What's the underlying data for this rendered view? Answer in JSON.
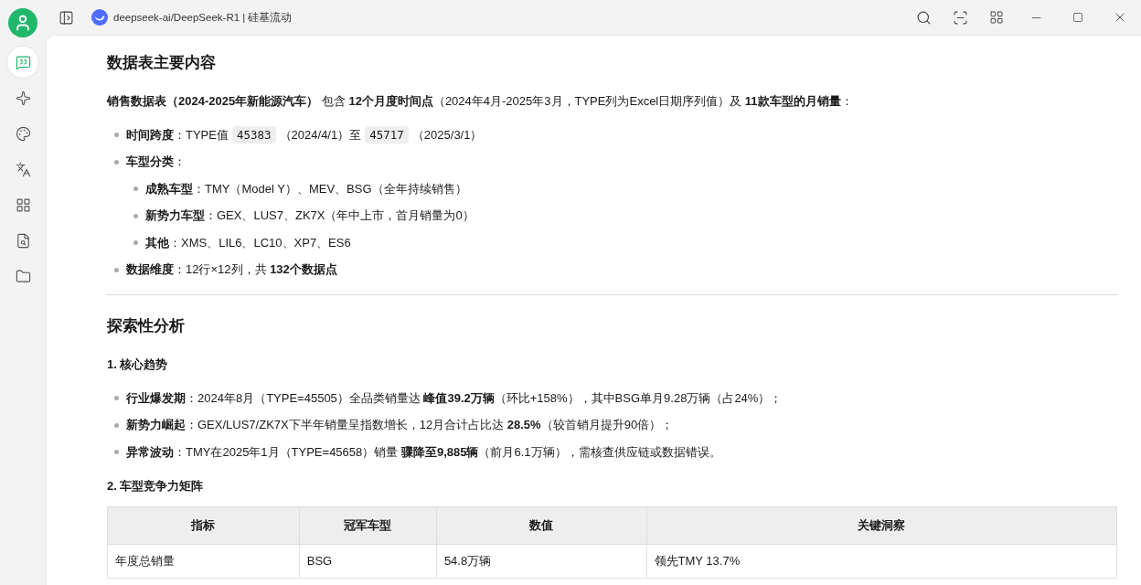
{
  "window": {
    "title": "deepseek-ai/DeepSeek-R1 | 硅基流动"
  },
  "sidebar": {
    "items": [
      {
        "selected": true
      },
      {
        "selected": false
      },
      {
        "selected": false
      },
      {
        "selected": false
      },
      {
        "selected": false
      },
      {
        "selected": false
      },
      {
        "selected": false
      }
    ]
  },
  "content": [
    {
      "kind": "heading",
      "text": "数据表主要内容"
    },
    {
      "kind": "paragraph",
      "text": "**销售数据表（2024-2025年新能源汽车）** 包含 **12个月度时间点**（2024年4月-2025年3月，TYPE列为Excel日期序列值）及 **11款车型的月销量**："
    },
    {
      "kind": "list",
      "items": [
        {
          "segments": [
            {
              "kind": "text",
              "text": "**时间跨度**：TYPE值"
            },
            {
              "kind": "code",
              "text": "45383"
            },
            {
              "kind": "text",
              "text": "（2024/4/1）至"
            },
            {
              "kind": "code",
              "text": "45717"
            },
            {
              "kind": "text",
              "text": "（2025/3/1）"
            }
          ]
        },
        {
          "segments": [
            {
              "kind": "text",
              "text": "**车型分类**："
            }
          ],
          "children": [
            {
              "segments": [
                {
                  "kind": "text",
                  "text": "**成熟车型**：TMY（Model Y）、MEV、BSG（全年持续销售）"
                }
              ]
            },
            {
              "segments": [
                {
                  "kind": "text",
                  "text": "**新势力车型**：GEX、LUS7、ZK7X（年中上市，首月销量为0）"
                }
              ]
            },
            {
              "segments": [
                {
                  "kind": "text",
                  "text": "**其他**：XMS、LIL6、LC10、XP7、ES6"
                }
              ]
            }
          ]
        },
        {
          "segments": [
            {
              "kind": "text",
              "text": "**数据维度**：12行×12列，共 **132个数据点**"
            }
          ]
        }
      ]
    },
    {
      "kind": "rule"
    },
    {
      "kind": "heading",
      "text": "探索性分析"
    },
    {
      "kind": "subheading",
      "text": "1. 核心趋势"
    },
    {
      "kind": "list",
      "items": [
        {
          "segments": [
            {
              "kind": "text",
              "text": "**行业爆发期**：2024年8月（TYPE=45505）全品类销量达 **峰值39.2万辆**（环比+158%），其中BSG单月9.28万辆（占24%）；"
            }
          ]
        },
        {
          "segments": [
            {
              "kind": "text",
              "text": "**新势力崛起**：GEX/LUS7/ZK7X下半年销量呈指数增长，12月合计占比达 **28.5%**（较首销月提升90倍）；"
            }
          ]
        },
        {
          "segments": [
            {
              "kind": "text",
              "text": "**异常波动**：TMY在2025年1月（TYPE=45658）销量 **骤降至9,885辆**（前月6.1万辆），需核查供应链或数据错误。"
            }
          ]
        }
      ]
    },
    {
      "kind": "subheading",
      "text": "2. 车型竞争力矩阵"
    },
    {
      "kind": "table",
      "columns": [
        "指标",
        "冠军车型",
        "数值",
        "关键洞察"
      ],
      "rows": [
        [
          "年度总销量",
          "BSG",
          "54.8万辆",
          "领先TMY 13.7%"
        ]
      ]
    }
  ]
}
